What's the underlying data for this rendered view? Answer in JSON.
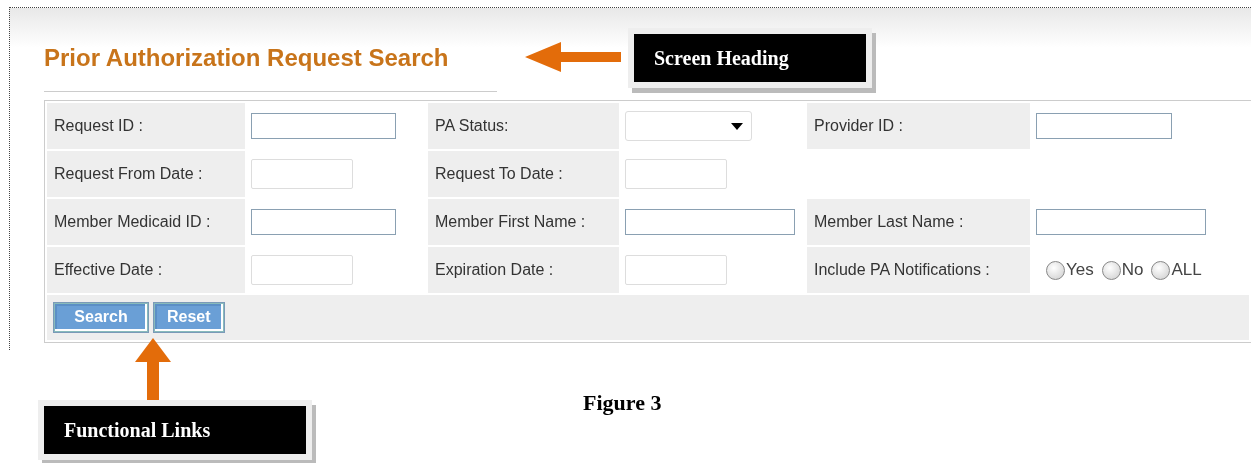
{
  "heading": "Prior Authorization Request Search",
  "rows": [
    [
      {
        "label": "Request ID :",
        "kind": "text"
      },
      {
        "label": "PA Status:",
        "kind": "select"
      },
      {
        "label": "Provider ID :",
        "kind": "short"
      }
    ],
    [
      {
        "label": "Request From Date :",
        "kind": "date"
      },
      {
        "label": "Request To Date :",
        "kind": "date"
      }
    ],
    [
      {
        "label": "Member Medicaid ID :",
        "kind": "text"
      },
      {
        "label": "Member First Name :",
        "kind": "wide"
      },
      {
        "label": "Member Last Name :",
        "kind": "wide"
      }
    ],
    [
      {
        "label": "Effective Date :",
        "kind": "date"
      },
      {
        "label": "Expiration Date :",
        "kind": "date"
      },
      {
        "label": "Include PA Notifications :",
        "kind": "radios",
        "options": [
          {
            "label": "Yes",
            "selected": false
          },
          {
            "label": "No",
            "selected": false
          },
          {
            "label": "ALL",
            "selected": false
          }
        ]
      }
    ]
  ],
  "buttons": [
    "Search",
    "Reset"
  ],
  "callouts": [
    {
      "text": "Screen Heading",
      "kind": "left"
    },
    {
      "text": "Functional Links",
      "kind": "up"
    }
  ],
  "caption": "Figure 3"
}
